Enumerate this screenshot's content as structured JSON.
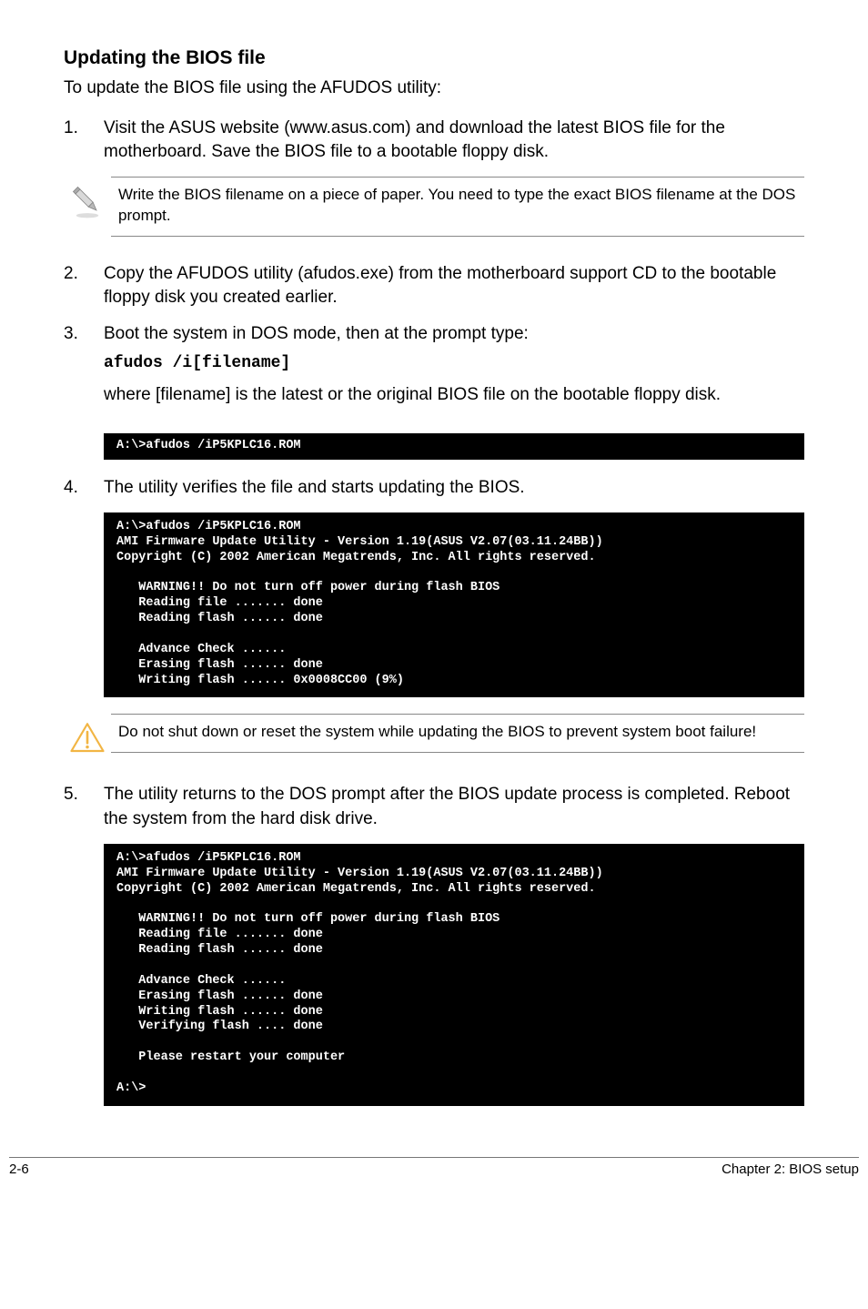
{
  "title": "Updating the BIOS file",
  "intro": "To update the BIOS file using the AFUDOS utility:",
  "steps": {
    "s1": {
      "num": "1.",
      "text": "Visit the ASUS website (www.asus.com) and download the latest BIOS file for the motherboard. Save the BIOS file to a bootable floppy disk."
    },
    "s2": {
      "num": "2.",
      "text": "Copy the AFUDOS utility (afudos.exe) from the motherboard support CD to the bootable floppy disk you created earlier."
    },
    "s3": {
      "num": "3.",
      "text": "Boot the system in DOS mode, then at the prompt type:"
    },
    "s4": {
      "num": "4.",
      "text": "The utility verifies the file and starts updating the BIOS."
    },
    "s5": {
      "num": "5.",
      "text": "The utility returns to the DOS prompt after the BIOS update process is completed. Reboot the system from the hard disk drive."
    }
  },
  "note1": "Write the BIOS filename on a piece of paper. You need to type the exact BIOS filename at the DOS prompt.",
  "cmd": "afudos /i[filename]",
  "cmd_explain": "where [filename] is the latest or the original BIOS file on the bootable floppy disk.",
  "term1": "A:\\>afudos /iP5KPLC16.ROM",
  "term2": "A:\\>afudos /iP5KPLC16.ROM\nAMI Firmware Update Utility - Version 1.19(ASUS V2.07(03.11.24BB))\nCopyright (C) 2002 American Megatrends, Inc. All rights reserved.\n\n   WARNING!! Do not turn off power during flash BIOS\n   Reading file ....... done\n   Reading flash ...... done\n\n   Advance Check ......\n   Erasing flash ...... done\n   Writing flash ...... 0x0008CC00 (9%)",
  "caution": "Do not shut down or reset the system while updating the BIOS to prevent system boot failure!",
  "term3": "A:\\>afudos /iP5KPLC16.ROM\nAMI Firmware Update Utility - Version 1.19(ASUS V2.07(03.11.24BB))\nCopyright (C) 2002 American Megatrends, Inc. All rights reserved.\n\n   WARNING!! Do not turn off power during flash BIOS\n   Reading file ....... done\n   Reading flash ...... done\n\n   Advance Check ......\n   Erasing flash ...... done\n   Writing flash ...... done\n   Verifying flash .... done\n\n   Please restart your computer\n\nA:\\>",
  "footer": {
    "left": "2-6",
    "right": "Chapter 2: BIOS setup"
  }
}
